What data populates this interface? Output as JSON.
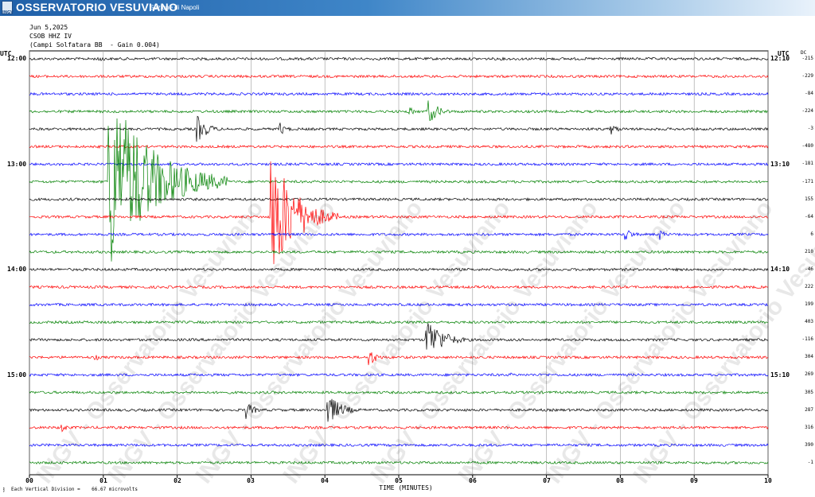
{
  "banner": {
    "title": "OSSERVATORIO VESUVIANO",
    "subtitle": "Sezione di Napoli",
    "logo_text": "INGV"
  },
  "header": {
    "date": "Jun 5,2025",
    "station": "CSOB HHZ IV",
    "description": "(Campi Solfatara BB  - Gain 0.004)"
  },
  "axes": {
    "left_label": "UTC",
    "right_label": "UTC",
    "dc_label": "DC",
    "left_times": [
      "12:00",
      "13:00",
      "14:00",
      "15:00"
    ],
    "right_times": [
      "12:10",
      "13:10",
      "14:10",
      "15:10"
    ],
    "x_ticks": [
      "00",
      "01",
      "02",
      "03",
      "04",
      "05",
      "06",
      "07",
      "08",
      "09",
      "10"
    ],
    "x_label": "TIME (MINUTES)",
    "footer": "Each Vertical Division =    66.67 microvolts"
  },
  "watermark": "INGV - Osservatorio Vesuviano",
  "colors": {
    "cycle": [
      "#000000",
      "#ff0000",
      "#0000ff",
      "#008000"
    ],
    "banner": "#1f5fa8",
    "grid": "#9a9a9a"
  },
  "chart_data": {
    "type": "line",
    "description_note": "helicorder, 24 traces of 10 minutes each, colors cycle black-red-blue-green",
    "dc_offsets": [
      "-215",
      "-229",
      "-84",
      "-224",
      "-3",
      "-480",
      "-181",
      "-171",
      "155",
      "-64",
      "6",
      "210",
      "-46",
      "222",
      "199",
      "403",
      "-116",
      "304",
      "269",
      "305",
      "287",
      "316",
      "390",
      "-1"
    ],
    "events": [
      {
        "trace": 0,
        "minute": 0.95,
        "amp": 5,
        "len": 0.2
      },
      {
        "trace": 2,
        "minute": 0.5,
        "amp": 2,
        "len": 0.3
      },
      {
        "trace": 3,
        "minute": 5.4,
        "amp": 16,
        "len": 0.4
      },
      {
        "trace": 3,
        "minute": 5.15,
        "amp": 6,
        "len": 0.2
      },
      {
        "trace": 4,
        "minute": 2.27,
        "amp": 18,
        "len": 0.4
      },
      {
        "trace": 4,
        "minute": 3.4,
        "amp": 8,
        "len": 0.25
      },
      {
        "trace": 4,
        "minute": 7.88,
        "amp": 7,
        "len": 0.3
      },
      {
        "trace": 7,
        "minute": 1.08,
        "amp": 118,
        "len": 1.6
      },
      {
        "trace": 9,
        "minute": 3.28,
        "amp": 85,
        "len": 0.9
      },
      {
        "trace": 10,
        "minute": 8.08,
        "amp": 8,
        "len": 0.3
      },
      {
        "trace": 10,
        "minute": 8.55,
        "amp": 6,
        "len": 0.2
      },
      {
        "trace": 16,
        "minute": 5.38,
        "amp": 30,
        "len": 0.6
      },
      {
        "trace": 17,
        "minute": 4.6,
        "amp": 12,
        "len": 0.3
      },
      {
        "trace": 17,
        "minute": 0.9,
        "amp": 4,
        "len": 0.2
      },
      {
        "trace": 18,
        "minute": 6.5,
        "amp": 3,
        "len": 0.3
      },
      {
        "trace": 20,
        "minute": 4.05,
        "amp": 20,
        "len": 0.5
      },
      {
        "trace": 20,
        "minute": 2.95,
        "amp": 10,
        "len": 0.3
      },
      {
        "trace": 21,
        "minute": 0.45,
        "amp": 6,
        "len": 0.2
      }
    ]
  }
}
